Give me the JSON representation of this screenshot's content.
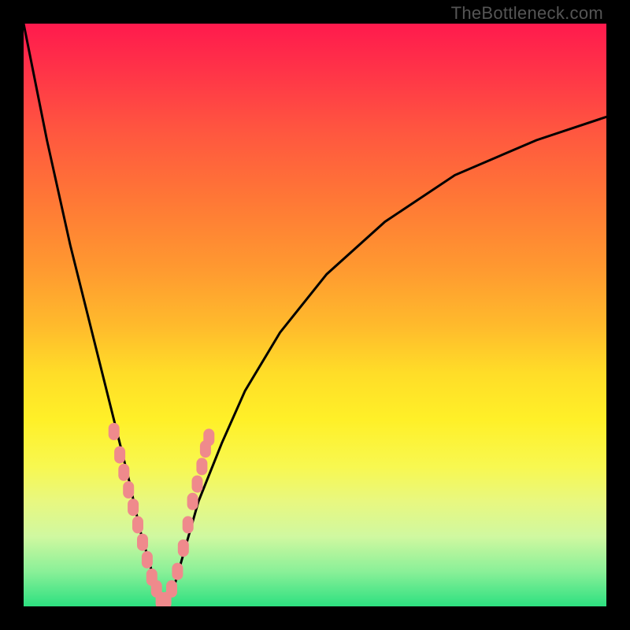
{
  "watermark": "TheBottleneck.com",
  "colors": {
    "frame": "#000000",
    "curve": "#000000",
    "marker": "#ef8a8c",
    "gradient_top": "#ff1a4d",
    "gradient_mid": "#ffdd28",
    "gradient_bottom": "#2de080"
  },
  "chart_data": {
    "type": "line",
    "title": "",
    "xlabel": "",
    "ylabel": "",
    "xlim": [
      0,
      100
    ],
    "ylim": [
      0,
      100
    ],
    "note": "V-shaped bottleneck curve. x is proportional position across plot width; y is bottleneck value (0 best at minimum, 100 worst). Curve minimum near x≈24.",
    "series": [
      {
        "name": "bottleneck-curve",
        "x": [
          0,
          4,
          8,
          12,
          14,
          16,
          18,
          20,
          22,
          24,
          26,
          28,
          30,
          34,
          38,
          44,
          52,
          62,
          74,
          88,
          100
        ],
        "y": [
          100,
          80,
          62,
          46,
          38,
          30,
          22,
          13,
          6,
          1,
          4,
          11,
          18,
          28,
          37,
          47,
          57,
          66,
          74,
          80,
          84
        ]
      }
    ],
    "markers": {
      "name": "highlighted-points",
      "note": "Salmon rounded-rect markers clustered on both flanks of the V near the minimum (roughly y between 2 and 30).",
      "x": [
        15.5,
        16.5,
        17.2,
        18.0,
        18.8,
        19.6,
        20.4,
        21.2,
        22.0,
        22.8,
        23.6,
        24.4,
        25.4,
        26.4,
        27.4,
        28.2,
        29.0,
        29.8,
        30.6,
        31.2,
        31.8
      ],
      "y": [
        30,
        26,
        23,
        20,
        17,
        14,
        11,
        8,
        5,
        3,
        1,
        1,
        3,
        6,
        10,
        14,
        18,
        21,
        24,
        27,
        29
      ]
    }
  }
}
